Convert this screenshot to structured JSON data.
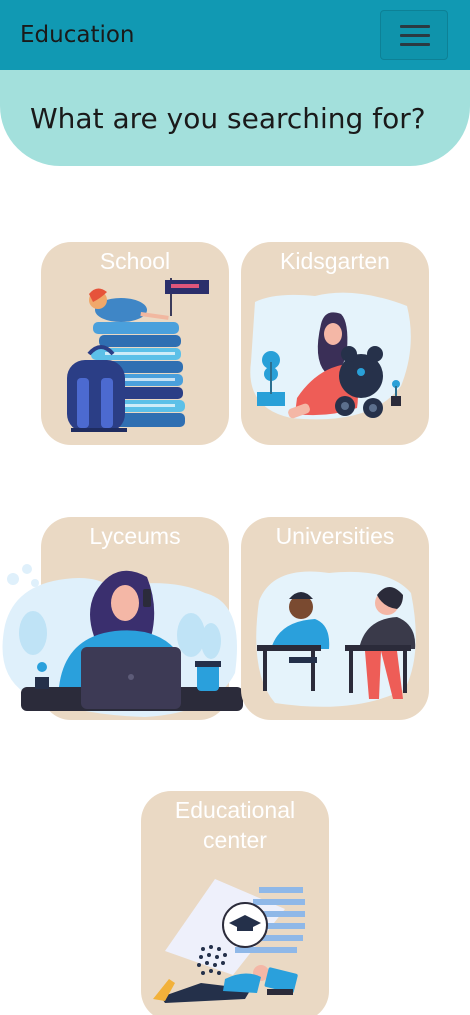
{
  "navbar": {
    "brand": "Education",
    "toggler_icon": "hamburger-menu-icon"
  },
  "hero": {
    "question": "What are you searching for?"
  },
  "categories": [
    {
      "label": "School",
      "illustration": "stack-of-books-backpack-icon"
    },
    {
      "label": "Kidsgarten",
      "illustration": "girl-with-teddy-bear-icon"
    },
    {
      "label": "Lyceums",
      "illustration": "student-at-laptop-icon"
    },
    {
      "label": "Universities",
      "illustration": "students-writing-exam-icon"
    },
    {
      "label": "Educational\ncenter",
      "illustration": "online-learning-graduation-cap-icon"
    }
  ],
  "colors": {
    "navbar": "#1199b3",
    "banner": "#a3e0dc",
    "card": "#ead9c4",
    "card_text": "#ffffff"
  }
}
